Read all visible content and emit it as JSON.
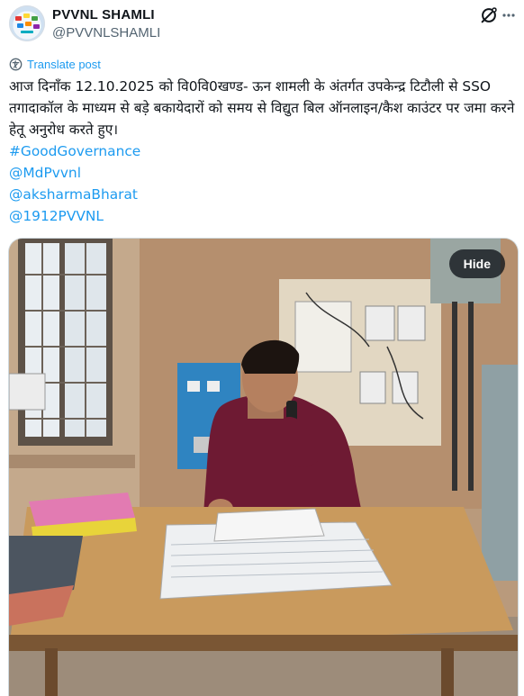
{
  "account": {
    "display_name": "PVVNL SHAMLI",
    "handle": "@PVVNLSHAMLI"
  },
  "actions": {
    "translate_label": "Translate post",
    "hide_label": "Hide"
  },
  "post": {
    "text": "आज दिनाँक 12.10.2025 को वि0वि0खण्ड- ऊन शामली के अंतर्गत उपकेन्द्र टिटौली से SSO तगादाकॉल के माध्यम से बड़े बकायेदारों को समय से विद्युत बिल ऑनलाइन/कैश काउंटर पर जमा करने हेतू अनुरोध करते हुए।",
    "hashtags": [
      "#GoodGovernance",
      "@MdPvvnl",
      "@aksharmaBharat",
      "@1912PVVNL"
    ]
  },
  "colors": {
    "link": "#1d9bf0",
    "secondary_text": "#536471",
    "text": "#0f1419"
  },
  "icons": [
    "grok-icon",
    "more-icon",
    "translate-icon"
  ]
}
